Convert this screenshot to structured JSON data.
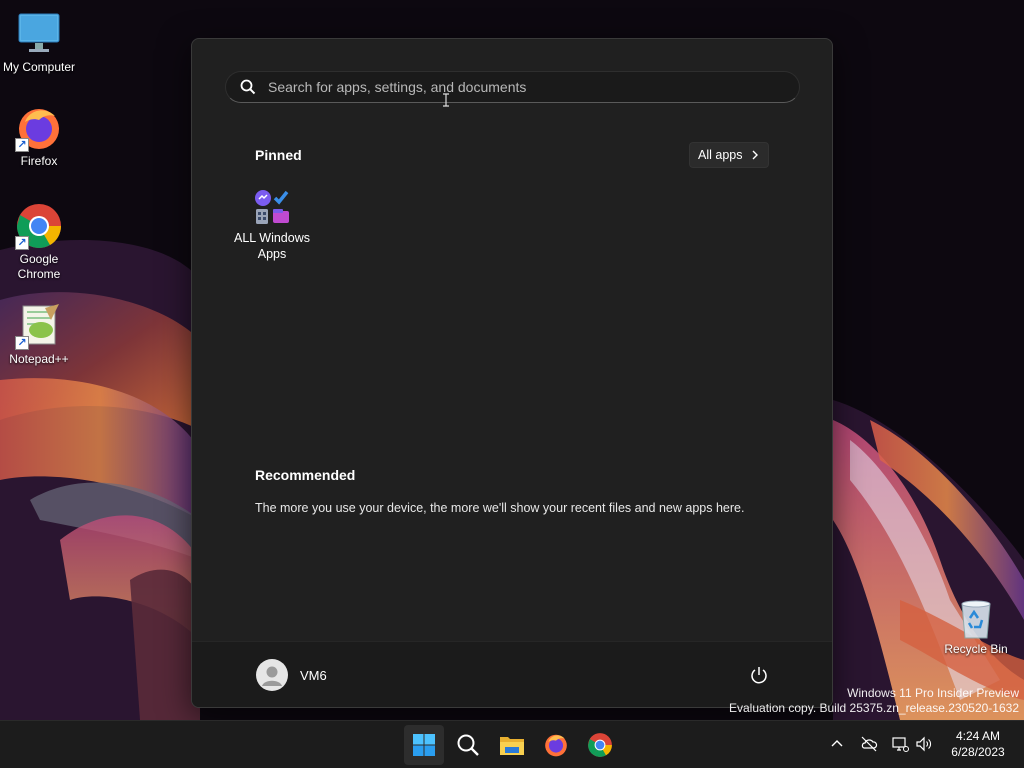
{
  "desktop": {
    "icons": [
      {
        "label": "My Computer",
        "icon": "monitor-icon"
      },
      {
        "label": "Firefox",
        "icon": "firefox-icon"
      },
      {
        "label": "Google Chrome",
        "icon": "chrome-icon"
      },
      {
        "label": "Notepad++",
        "icon": "notepad-plus-plus-icon"
      }
    ],
    "recycle_bin": {
      "label": "Recycle Bin",
      "icon": "recycle-bin-icon"
    }
  },
  "start_menu": {
    "search": {
      "placeholder": "Search for apps, settings, and documents",
      "value": ""
    },
    "pinned": {
      "title": "Pinned",
      "all_apps_label": "All apps",
      "apps": [
        {
          "label": "ALL Windows Apps",
          "icon": "app-folder-icon"
        }
      ]
    },
    "recommended": {
      "title": "Recommended",
      "empty_text": "The more you use your device, the more we'll show your recent files and new apps here."
    },
    "user": {
      "name": "VM6"
    },
    "power_icon": "power-icon"
  },
  "watermark": {
    "line1": "Windows 11 Pro Insider Preview",
    "line2": "Evaluation copy. Build 25375.zn_release.230520-1632"
  },
  "taskbar": {
    "apps": [
      "start-icon",
      "search-icon",
      "file-explorer-icon",
      "firefox-icon",
      "chrome-icon"
    ],
    "tray": [
      "chevron-up-icon",
      "cloud-off-icon",
      "network-icon",
      "volume-icon"
    ],
    "clock": {
      "time": "4:24 AM",
      "date": "6/28/2023"
    }
  },
  "colors": {
    "start_bg": "#202020",
    "taskbar_bg": "#1c1c1c",
    "accent": "#0078d4"
  }
}
